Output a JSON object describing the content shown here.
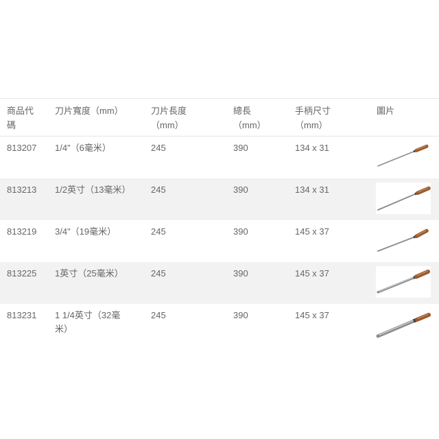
{
  "theme": {
    "text_color": "#666666",
    "stripe_color": "#f2f2f2",
    "border_color": "#e6e6e6",
    "handle_color": "#9a5b2e",
    "blade_color": "#8c8c8c"
  },
  "table": {
    "headers": {
      "code": "商品代碼",
      "blade_width": "刀片寬度（mm）",
      "blade_length": "刀片長度（mm）",
      "total_length": "總長（mm）",
      "handle_size": "手柄尺寸（mm）",
      "image": "圖片"
    },
    "rows": [
      {
        "code": "813207",
        "blade_width": "1/4\"（6毫米）",
        "blade_length": "245",
        "total_length": "390",
        "handle_size": "134 x 31",
        "image_icon": "thin-blade-tool-image"
      },
      {
        "code": "813213",
        "blade_width": "1/2英寸（13毫米）",
        "blade_length": "245",
        "total_length": "390",
        "handle_size": "134 x 31",
        "image_icon": "thin-blade-tool-image"
      },
      {
        "code": "813219",
        "blade_width": "3/4\"（19毫米）",
        "blade_length": "245",
        "total_length": "390",
        "handle_size": "145 x 37",
        "image_icon": "thin-blade-tool-image"
      },
      {
        "code": "813225",
        "blade_width": "1英寸（25毫米）",
        "blade_length": "245",
        "total_length": "390",
        "handle_size": "145 x 37",
        "image_icon": "flat-blade-tool-image"
      },
      {
        "code": "813231",
        "blade_width": "1 1/4英寸（32毫米）",
        "blade_length": "245",
        "total_length": "390",
        "handle_size": "145 x 37",
        "image_icon": "wide-flat-blade-tool-image"
      }
    ]
  }
}
